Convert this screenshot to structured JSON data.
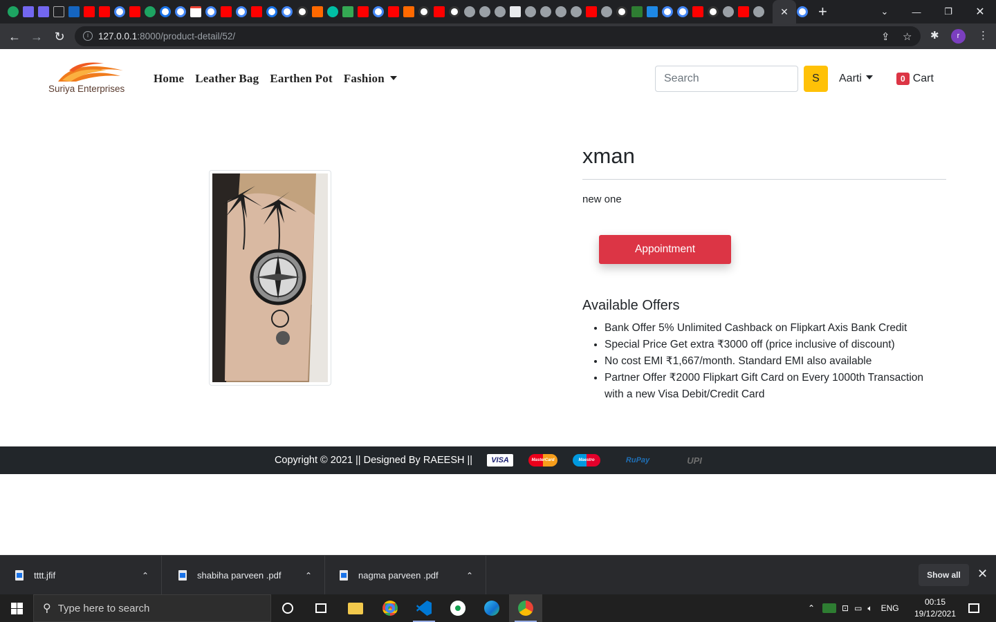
{
  "browser": {
    "url_host": "127.0.0.1",
    "url_path": ":8000/product-detail/52/",
    "profile_initial": "r",
    "window_controls": [
      "minimize",
      "restore",
      "close"
    ]
  },
  "site": {
    "logo_text": "Suriya Enterprises",
    "nav": {
      "home": "Home",
      "leather_bag": "Leather Bag",
      "earthen_pot": "Earthen Pot",
      "fashion": "Fashion"
    },
    "search": {
      "placeholder": "Search",
      "button_label": "S"
    },
    "user_name": "Aarti",
    "cart": {
      "count": "0",
      "label": "Cart"
    }
  },
  "product": {
    "title": "xman",
    "description": "new one",
    "appointment_label": "Appointment",
    "offers_title": "Available Offers",
    "offers": [
      "Bank Offer 5% Unlimited Cashback on Flipkart Axis Bank Credit",
      "Special Price Get extra ₹3000 off (price inclusive of discount)",
      "No cost EMI ₹1,667/month. Standard EMI also available",
      "Partner Offer ₹2000 Flipkart Gift Card on Every 1000th Transaction with a new Visa Debit/Credit Card"
    ]
  },
  "footer": {
    "text": "Copyright © 2021 || Designed By RAEESH ||",
    "payment_logos": [
      "VISA",
      "MasterCard",
      "Maestro",
      "RuPay",
      "UPI"
    ]
  },
  "downloads": {
    "items": [
      {
        "name": "tttt.jfif"
      },
      {
        "name": "shabiha parveen .pdf"
      },
      {
        "name": "nagma parveen .pdf"
      }
    ],
    "show_all": "Show all"
  },
  "taskbar": {
    "search_placeholder": "Type here to search",
    "language": "ENG",
    "time": "00:15",
    "date": "19/12/2021"
  },
  "colors": {
    "accent_yellow": "#ffc107",
    "danger_red": "#dc3545",
    "footer_bg": "#22262a",
    "chrome_dark": "#202124"
  }
}
